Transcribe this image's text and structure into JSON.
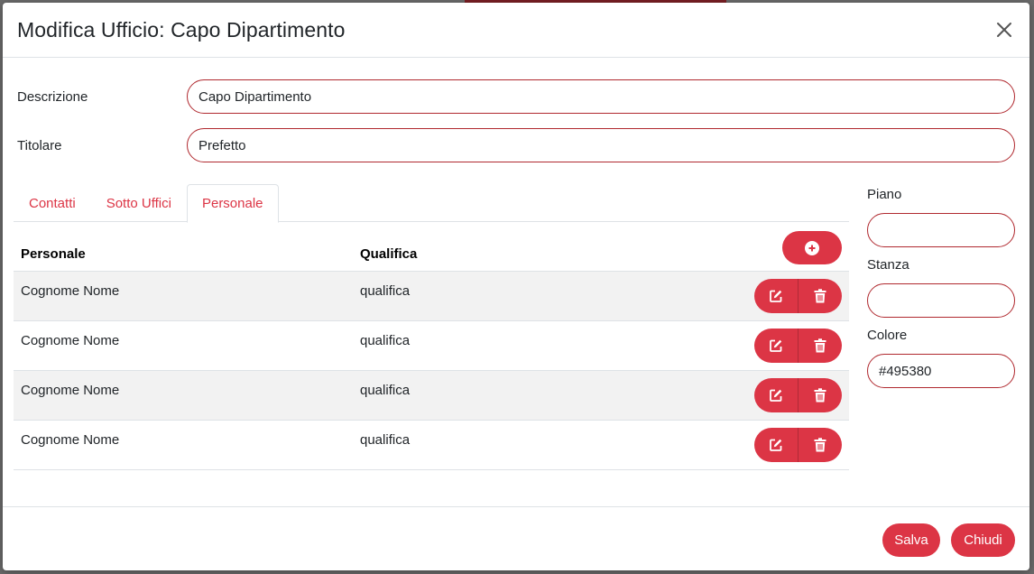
{
  "modal": {
    "title": "Modifica Ufficio: Capo Dipartimento",
    "close_icon": "close-icon"
  },
  "form": {
    "descrizione_label": "Descrizione",
    "descrizione_value": "Capo Dipartimento",
    "titolare_label": "Titolare",
    "titolare_value": "Prefetto"
  },
  "tabs": [
    {
      "label": "Contatti",
      "active": false
    },
    {
      "label": "Sotto Uffici",
      "active": false
    },
    {
      "label": "Personale",
      "active": true
    }
  ],
  "table": {
    "headers": [
      "Personale",
      "Qualifica"
    ],
    "add_icon": "plus-circle-icon",
    "rows": [
      {
        "personale": "Cognome Nome",
        "qualifica": "qualifica"
      },
      {
        "personale": "Cognome Nome",
        "qualifica": "qualifica"
      },
      {
        "personale": "Cognome Nome",
        "qualifica": "qualifica"
      },
      {
        "personale": "Cognome Nome",
        "qualifica": "qualifica"
      }
    ],
    "edit_icon": "edit-icon",
    "delete_icon": "trash-icon"
  },
  "side": {
    "piano_label": "Piano",
    "piano_value": "",
    "stanza_label": "Stanza",
    "stanza_value": "",
    "colore_label": "Colore",
    "colore_value": "#495380"
  },
  "footer": {
    "save_label": "Salva",
    "close_label": "Chiudi"
  },
  "colors": {
    "accent": "#dc3545",
    "input_border": "#b0292f"
  }
}
